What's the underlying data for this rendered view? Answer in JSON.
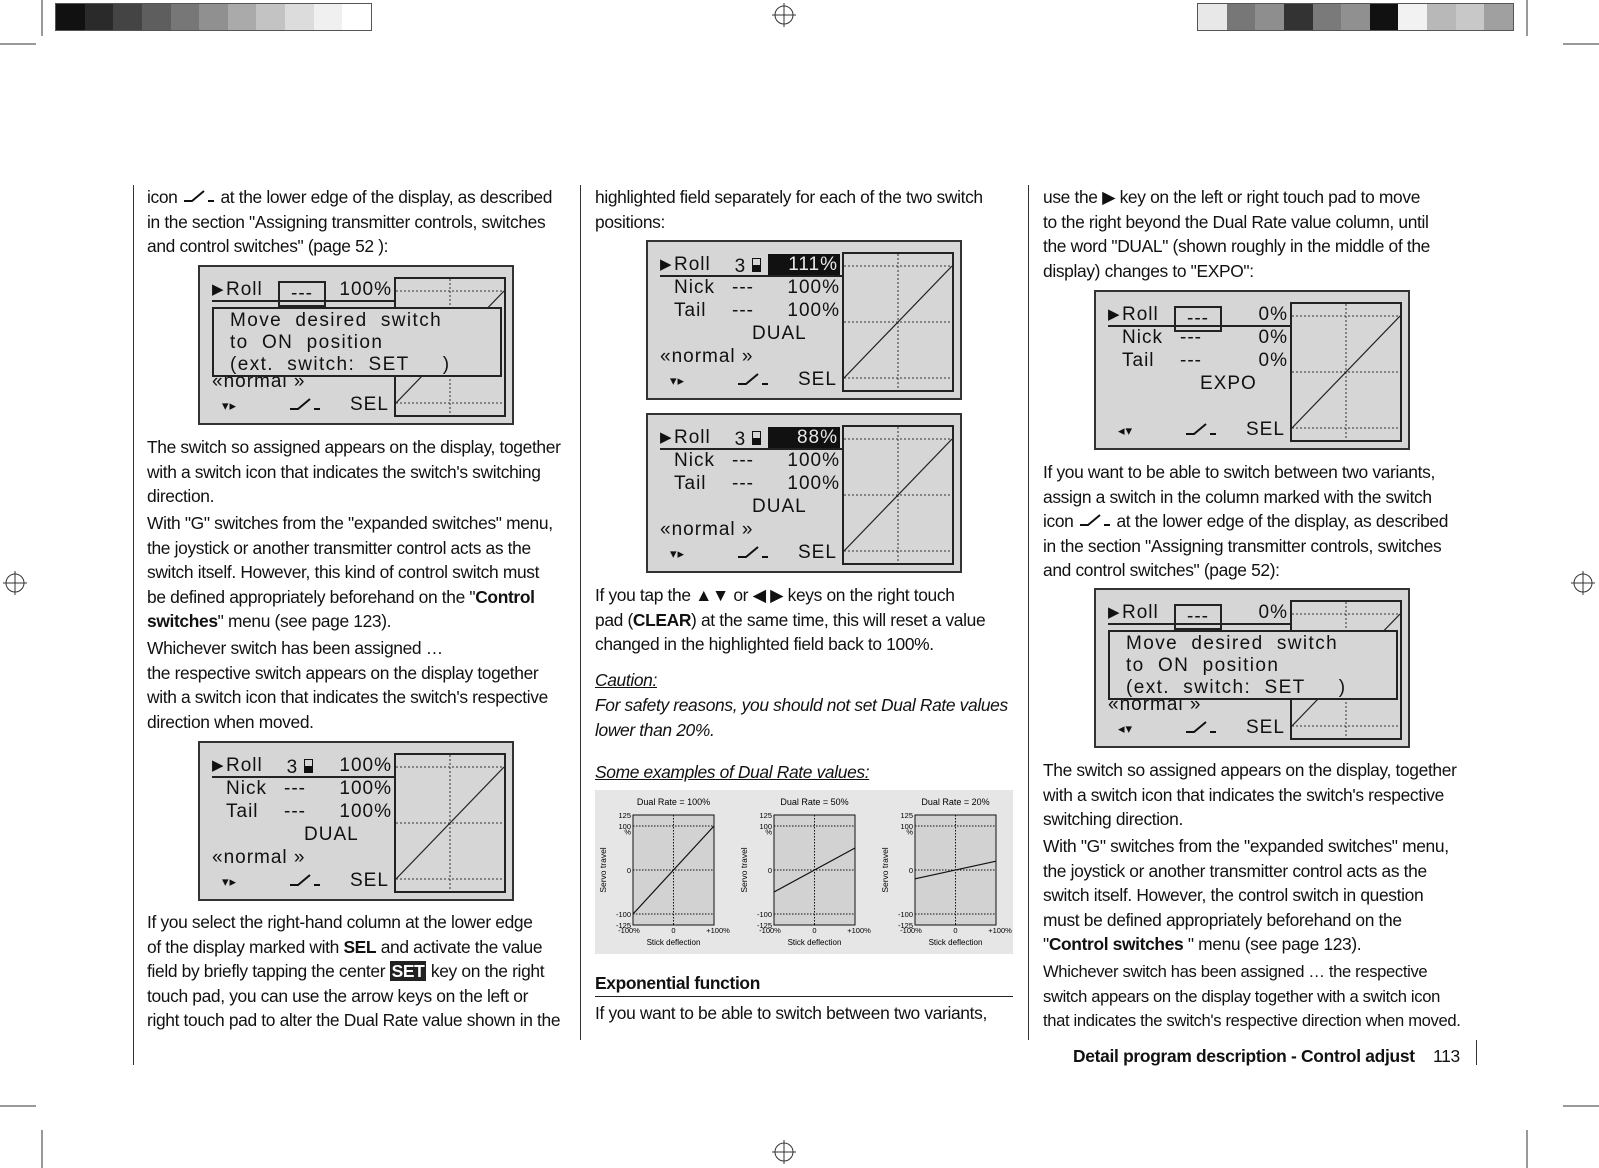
{
  "left": {
    "p1": [
      "icon ",
      " at the lower edge of the display, as described",
      "in the section \"Assigning transmitter controls, switches",
      "and control switches\" (page 52 ):"
    ],
    "p2": [
      "The switch so assigned appears on the display, together",
      "with a switch icon that indicates the switch's switching",
      "direction."
    ],
    "p3a": [
      "With \"G\" switches from the \"expanded switches\" menu,",
      "the joystick or another transmitter control acts as the",
      "switch itself. However, this kind of control switch must",
      "be defined appropriately beforehand on the \""
    ],
    "p3b": {
      "bold1": "Control",
      "bold2": "switches",
      "rest": "\" menu (see page 123)."
    },
    "p4": [
      "Whichever switch has been assigned …",
      "the respective switch appears on the display together",
      "with a switch icon that indicates the switch's respective",
      "direction when moved."
    ],
    "p5": {
      "l1a": "If you select the right-hand column at the lower edge",
      "l2a": "of the display marked with ",
      "sel": "SEL",
      "l2b": " and activate the value",
      "l3a": "field by briefly tapping the center ",
      "set": "SET",
      "l3b": " key on the right",
      "l4": "touch pad, you can use the arrow keys on the left or",
      "l5": "right touch pad to alter the Dual Rate value shown in the"
    }
  },
  "middle": {
    "p1": [
      "highlighted field separately for each of the two switch",
      "positions:"
    ],
    "p2": {
      "l1a": "If you tap the ",
      "l1b": " or ",
      "l1c": " keys on the right touch",
      "l2a": "pad (",
      "clear": "CLEAR",
      "l2b": ") at the same time, this will reset a value",
      "l3": "changed in the highlighted field back to 100%."
    },
    "caution_title": "Caution:",
    "caution": [
      "For safety reasons, you should not set Dual Rate values",
      "lower than 20%."
    ],
    "examples_title": "Some examples of Dual Rate values:",
    "exp_heading": "Exponential function",
    "p3": "If you want to be able to switch between two variants,"
  },
  "right": {
    "p1": {
      "l1a": "use the ",
      "l1b": " key on the left or right touch pad to move",
      "l2": "to the right beyond the Dual Rate value column, until",
      "l3": "the word \"DUAL\" (shown roughly in the middle of the",
      "l4": "display) changes to \"EXPO\":"
    },
    "p2": [
      "If you want to be able to switch between two variants,",
      "assign a switch in the column marked with the switch",
      "icon ",
      " at the lower edge of the display, as described",
      "in the section \"Assigning transmitter controls, switches",
      "and control switches\" (page 52):"
    ],
    "p3": [
      "The switch so assigned appears on the display, together",
      "with a switch icon that indicates the switch's respective",
      "switching direction."
    ],
    "p4a": [
      "With \"G\" switches from the \"expanded switches\" menu,",
      "the joystick or another transmitter control acts as the",
      "switch itself. However, the control switch in question",
      "must be defined appropriately beforehand on the"
    ],
    "p4b": {
      "q": "\"",
      "bold": "Control switches ",
      "rest": "\" menu (see page 123)."
    },
    "p5": [
      "Whichever switch has been assigned … the respective",
      "switch appears on the display together with a switch icon",
      "that indicates the switch's respective direction when moved."
    ]
  },
  "footer": {
    "section": "Detail program description - Control adjust",
    "page": "113"
  },
  "lcds": [
    {
      "rows": [
        [
          "Roll",
          "---",
          "100%"
        ]
      ],
      "popup": [
        "Move  desired  switch",
        "to  ON  position",
        "(ext.  switch:  SET     )"
      ],
      "under": "«normal »",
      "sel": "SEL",
      "nav": "down-right"
    },
    {
      "rows": [
        [
          "Roll",
          "3",
          "100%"
        ],
        [
          "Nick",
          "---",
          "100%"
        ],
        [
          "Tail",
          "---",
          "100%"
        ]
      ],
      "mode": "DUAL",
      "under": "«normal »",
      "sel": "SEL",
      "nav": "down-right"
    },
    {
      "rows": [
        [
          "Roll",
          "3",
          "111%"
        ],
        [
          "Nick",
          "---",
          "100%"
        ],
        [
          "Tail",
          "---",
          "100%"
        ]
      ],
      "mode": "DUAL",
      "under": "«normal »",
      "sel": "SEL",
      "nav": "down-right",
      "hl": true
    },
    {
      "rows": [
        [
          "Roll",
          "3",
          "88%"
        ],
        [
          "Nick",
          "---",
          "100%"
        ],
        [
          "Tail",
          "---",
          "100%"
        ]
      ],
      "mode": "DUAL",
      "under": "«normal »",
      "sel": "SEL",
      "nav": "down-right",
      "hl": true
    },
    {
      "rows": [
        [
          "Roll",
          "---",
          "0%"
        ],
        [
          "Nick",
          "---",
          "0%"
        ],
        [
          "Tail",
          "---",
          "0%"
        ]
      ],
      "mode": "EXPO",
      "under": "",
      "sel": "SEL",
      "nav": "left-down",
      "flat": true
    },
    {
      "rows": [
        [
          "Roll",
          "---",
          "0%"
        ]
      ],
      "popup": [
        "Move  desired  switch",
        "to  ON  position",
        "(ext.  switch:  SET     )"
      ],
      "under": "«normal »",
      "sel": "SEL",
      "nav": "left-down",
      "flat": true
    }
  ],
  "chart_data": [
    {
      "type": "line",
      "title": "Dual Rate = 100%",
      "xlabel": "Stick deflection",
      "ylabel": "Servo travel",
      "xticks": [
        "-100%",
        "0",
        "+100%"
      ],
      "yticks": [
        "125",
        "100",
        "%",
        "0",
        "-100",
        "-125"
      ],
      "xlim": [
        -100,
        100
      ],
      "ylim": [
        -125,
        125
      ],
      "x": [
        -100,
        100
      ],
      "y": [
        -100,
        100
      ]
    },
    {
      "type": "line",
      "title": "Dual Rate = 50%",
      "xlabel": "Stick deflection",
      "ylabel": "Servo travel",
      "xticks": [
        "-100%",
        "0",
        "+100%"
      ],
      "yticks": [
        "125",
        "100",
        "%",
        "0",
        "-100",
        "-125"
      ],
      "xlim": [
        -100,
        100
      ],
      "ylim": [
        -125,
        125
      ],
      "x": [
        -100,
        100
      ],
      "y": [
        -50,
        50
      ]
    },
    {
      "type": "line",
      "title": "Dual Rate = 20%",
      "xlabel": "Stick deflection",
      "ylabel": "Servo travel",
      "xticks": [
        "-100%",
        "0",
        "+100%"
      ],
      "yticks": [
        "125",
        "100",
        "%",
        "0",
        "-100",
        "-125"
      ],
      "xlim": [
        -100,
        100
      ],
      "ylim": [
        -125,
        125
      ],
      "x": [
        -100,
        100
      ],
      "y": [
        -20,
        20
      ]
    }
  ],
  "colors": {
    "lcd_bg": "#d6d6d6",
    "chart_bg": "#e6e6e6",
    "plot_bg": "#d2d2d2"
  }
}
